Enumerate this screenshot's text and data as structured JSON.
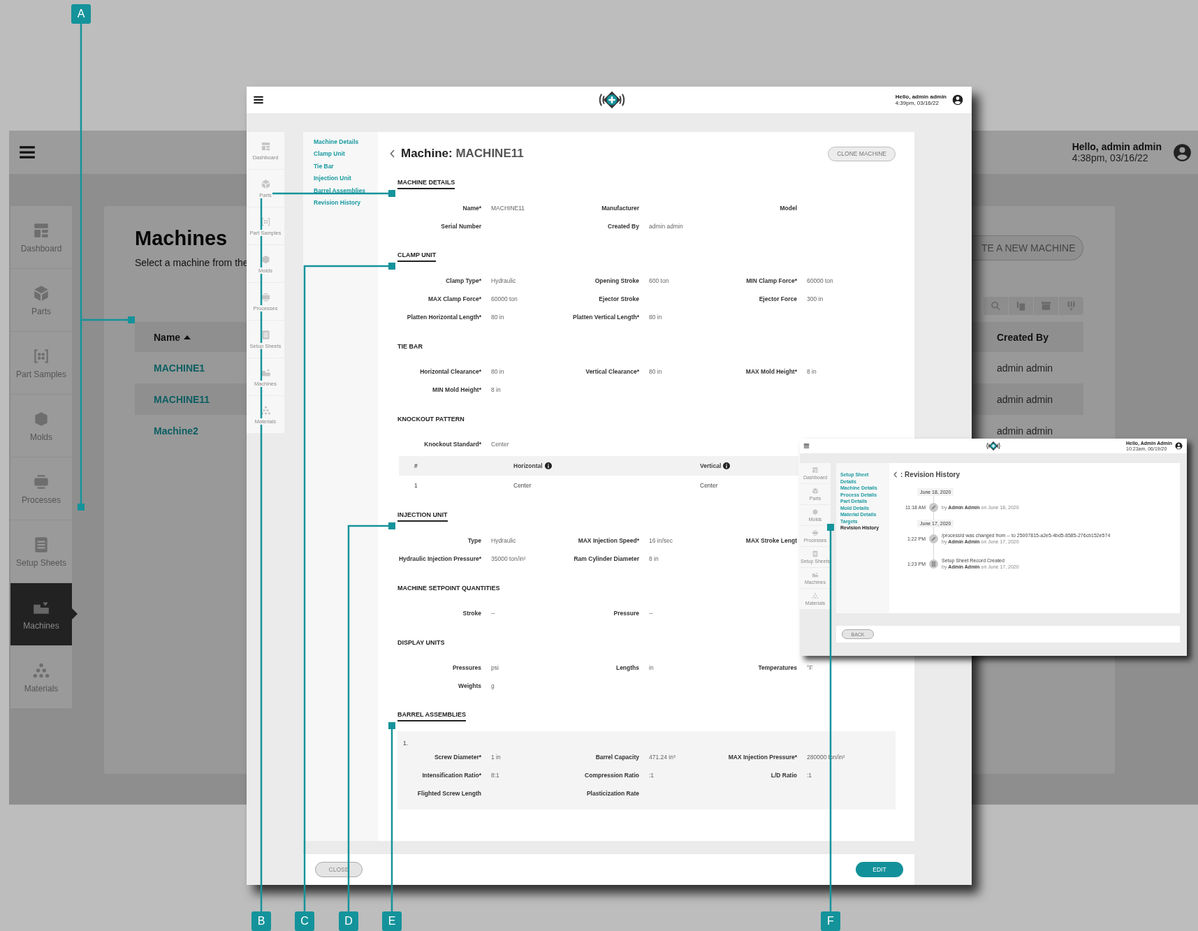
{
  "background_app": {
    "greeting": "Hello, admin admin",
    "time": "4:38pm, 03/16/22",
    "sidebar": [
      {
        "label": "Dashboard",
        "selected": false
      },
      {
        "label": "Parts",
        "selected": false
      },
      {
        "label": "Part Samples",
        "selected": false
      },
      {
        "label": "Molds",
        "selected": false
      },
      {
        "label": "Processes",
        "selected": false
      },
      {
        "label": "Setup Sheets",
        "selected": false
      },
      {
        "label": "Machines",
        "selected": true
      },
      {
        "label": "Materials",
        "selected": false
      }
    ],
    "title": "Machines",
    "subtitle": "Select a machine from the",
    "create_button": "TE A NEW MACHINE",
    "table": {
      "columns": [
        "Name",
        "Created By"
      ],
      "rows": [
        {
          "name": "MACHINE1",
          "created_by": "admin admin"
        },
        {
          "name": "MACHINE11",
          "created_by": "admin admin"
        },
        {
          "name": "Machine2",
          "created_by": "admin admin"
        }
      ]
    }
  },
  "main_window": {
    "greeting": "Hello, admin admin",
    "time": "4:39pm, 03/16/22",
    "sidebar": [
      "Dashboard",
      "Parts",
      "Part Samples",
      "Molds",
      "Processes",
      "Setup Sheets",
      "Machines",
      "Materials"
    ],
    "nav": [
      "Machine Details",
      "Clamp Unit",
      "Tie Bar",
      "Injection Unit",
      "Barrel Assemblies",
      "Revision History"
    ],
    "title_prefix": "Machine:",
    "title_name": "MACHINE11",
    "clone_button": "CLONE MACHINE",
    "sections": [
      {
        "heading": "MACHINE DETAILS",
        "kind": "major",
        "fields": [
          {
            "label": "Name*",
            "value": "MACHINE11"
          },
          {
            "label": "Manufacturer"
          },
          {
            "label": "Model"
          },
          {
            "label": "Serial Number"
          },
          {
            "label": "Created By",
            "value": "admin admin"
          }
        ]
      },
      {
        "heading": "CLAMP UNIT",
        "kind": "major",
        "fields": [
          {
            "label": "Clamp Type*",
            "value": "Hydraulic"
          },
          {
            "label": "Opening Stroke",
            "value": "600 ton"
          },
          {
            "label": "MIN Clamp Force*",
            "value": "60000 ton"
          },
          {
            "label": "MAX Clamp Force*",
            "value": "60000 ton"
          },
          {
            "label": "Ejector Stroke"
          },
          {
            "label": "Ejector Force",
            "value": "300 in"
          },
          {
            "label": "Platten Horizontal Length*",
            "value": "80 in"
          },
          {
            "label": "Platten Vertical Length*",
            "value": "80 in"
          }
        ]
      },
      {
        "heading": "TIE BAR",
        "kind": "minor",
        "fields": [
          {
            "label": "Horizontal Clearance*",
            "value": "80 in"
          },
          {
            "label": "Vertical Clearance*",
            "value": "80 in"
          },
          {
            "label": "MAX Mold Height*",
            "value": "8 in"
          },
          {
            "label": "MIN Mold Height*",
            "value": "8 in"
          }
        ]
      },
      {
        "heading": "KNOCKOUT PATTERN",
        "kind": "minor",
        "fields": [
          {
            "label": "Knockout Standard*",
            "value": "Center"
          }
        ],
        "table": {
          "columns": [
            {
              "label": "#",
              "info": false
            },
            {
              "label": "Horizontal",
              "info": true
            },
            {
              "label": "Vertical",
              "info": true
            }
          ],
          "rows": [
            [
              "1",
              "Center",
              "Center"
            ]
          ]
        }
      },
      {
        "heading": "INJECTION UNIT",
        "kind": "major",
        "fields": [
          {
            "label": "Type",
            "value": "Hydraulic"
          },
          {
            "label": "MAX Injection Speed*",
            "value": "16 in/sec"
          },
          {
            "label": "MAX Stroke Lengt"
          },
          {
            "label": "Hydraulic Injection Pressure*",
            "value": "35000 ton/in²"
          },
          {
            "label": "Ram Cylinder Diameter",
            "value": "8 in"
          }
        ]
      },
      {
        "heading": "MACHINE SETPOINT QUANTITIES",
        "kind": "minor",
        "fields": [
          {
            "label": "Stroke",
            "value": "--"
          },
          {
            "label": "Pressure",
            "value": "--"
          }
        ]
      },
      {
        "heading": "DISPLAY UNITS",
        "kind": "minor",
        "fields": [
          {
            "label": "Pressures",
            "value": "psi"
          },
          {
            "label": "Lengths",
            "value": "in"
          },
          {
            "label": "Temperatures",
            "value": "°F"
          },
          {
            "label": "Weights",
            "value": "g"
          }
        ]
      },
      {
        "heading": "BARREL ASSEMBLIES",
        "kind": "major",
        "barrels": [
          {
            "number": "1.",
            "fields": [
              {
                "label": "Screw Diameter*",
                "value": "1 in"
              },
              {
                "label": "Barrel Capacity",
                "value": "471.24 in³"
              },
              {
                "label": "MAX Injection Pressure*",
                "value": "280000 ton/in²"
              },
              {
                "label": "Intensification Ratio*",
                "value": "8:1"
              },
              {
                "label": "Compression Ratio",
                "value": ":1"
              },
              {
                "label": "L/D Ratio",
                "value": ":1"
              },
              {
                "label": "Flighted Screw Length"
              },
              {
                "label": "Plasticization Rate"
              }
            ]
          }
        ]
      }
    ],
    "close_button": "CLOSE",
    "edit_button": "EDIT"
  },
  "revision_window": {
    "greeting": "Hello, Admin Admin",
    "time": "10:23am, 06/19/20",
    "sidebar": [
      "Dashboard",
      "Parts",
      "Molds",
      "Processes",
      "Setup Sheets",
      "Machines",
      "Materials"
    ],
    "nav": [
      {
        "label": "Setup Sheet",
        "selected": false
      },
      {
        "label": "Details",
        "selected": false
      },
      {
        "label": "Machine Details",
        "selected": false
      },
      {
        "label": "Process Details",
        "selected": false
      },
      {
        "label": "Part Details",
        "selected": false
      },
      {
        "label": "Mold Details",
        "selected": false
      },
      {
        "label": "Material Details",
        "selected": false
      },
      {
        "label": "Targets",
        "selected": false
      },
      {
        "label": "Revision History",
        "selected": true
      }
    ],
    "title": ": Revision History",
    "days": [
      {
        "date": "June 18, 2020",
        "entries": [
          {
            "time": "11:18 AM",
            "kind": "edit",
            "by_line": "by **Admin Admin** on June 18, 2020"
          }
        ]
      },
      {
        "date": "June 17, 2020",
        "entries": [
          {
            "time": "1:22 PM",
            "kind": "edit",
            "text": "/processId was changed from -- to 25007815-a2e5-4bd5-8585-276cb152e574",
            "by_line": "by **Admin Admin** on June 17, 2020"
          },
          {
            "time": "1:23 PM",
            "kind": "created",
            "text": "Setup Sheet Record Created",
            "by_line": "by **Admin Admin** on June 17, 2020"
          }
        ]
      }
    ],
    "back_button": "BACK"
  },
  "callouts": [
    "A",
    "B",
    "C",
    "D",
    "E",
    "F"
  ]
}
